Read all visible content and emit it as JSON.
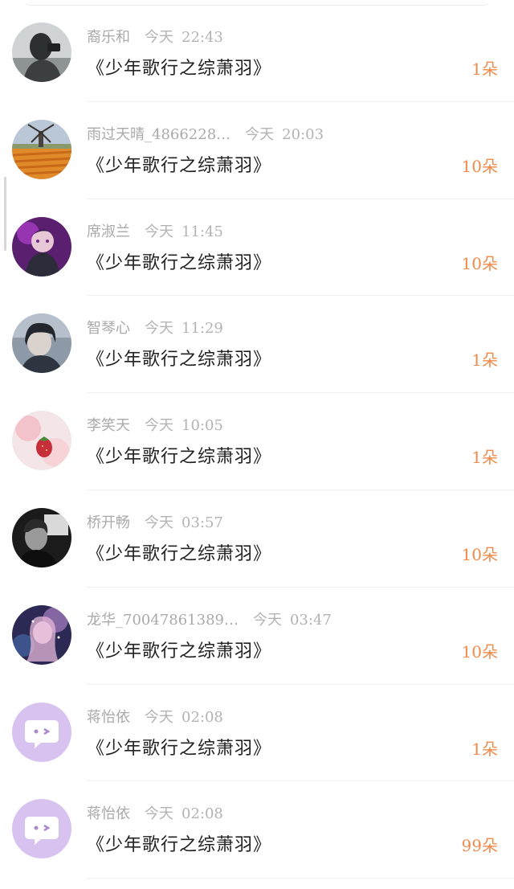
{
  "colors": {
    "accent": "#ef8a4a",
    "meta_text": "#aaaaaa",
    "title_text": "#222222"
  },
  "gifts": [
    {
      "name": "裔乐和",
      "day": "今天",
      "time": "22:43",
      "title": "《少年歌行之综萧羽》",
      "amount": "1朵",
      "avatar": "black-white-portrait"
    },
    {
      "name": "雨过天晴_4866228…",
      "day": "今天",
      "time": "20:03",
      "title": "《少年歌行之综萧羽》",
      "amount": "10朵",
      "avatar": "tulip-field-windmill"
    },
    {
      "name": "席淑兰",
      "day": "今天",
      "time": "11:45",
      "title": "《少年歌行之综萧羽》",
      "amount": "10朵",
      "avatar": "purple-anime"
    },
    {
      "name": "智琴心",
      "day": "今天",
      "time": "11:29",
      "title": "《少年歌行之综萧羽》",
      "amount": "1朵",
      "avatar": "dark-anime-boy"
    },
    {
      "name": "李笑天",
      "day": "今天",
      "time": "10:05",
      "title": "《少年歌行之综萧羽》",
      "amount": "1朵",
      "avatar": "strawberry-dessert"
    },
    {
      "name": "桥开畅",
      "day": "今天",
      "time": "03:57",
      "title": "《少年歌行之综萧羽》",
      "amount": "10朵",
      "avatar": "monochrome-man"
    },
    {
      "name": "龙华_70047861389…",
      "day": "今天",
      "time": "03:47",
      "title": "《少年歌行之综萧羽》",
      "amount": "10朵",
      "avatar": "fantasy-girl"
    },
    {
      "name": "蒋怡依",
      "day": "今天",
      "time": "02:08",
      "title": "《少年歌行之综萧羽》",
      "amount": "1朵",
      "avatar": "default-chat-bubble"
    },
    {
      "name": "蒋怡依",
      "day": "今天",
      "time": "02:08",
      "title": "《少年歌行之综萧羽》",
      "amount": "99朵",
      "avatar": "default-chat-bubble"
    }
  ]
}
